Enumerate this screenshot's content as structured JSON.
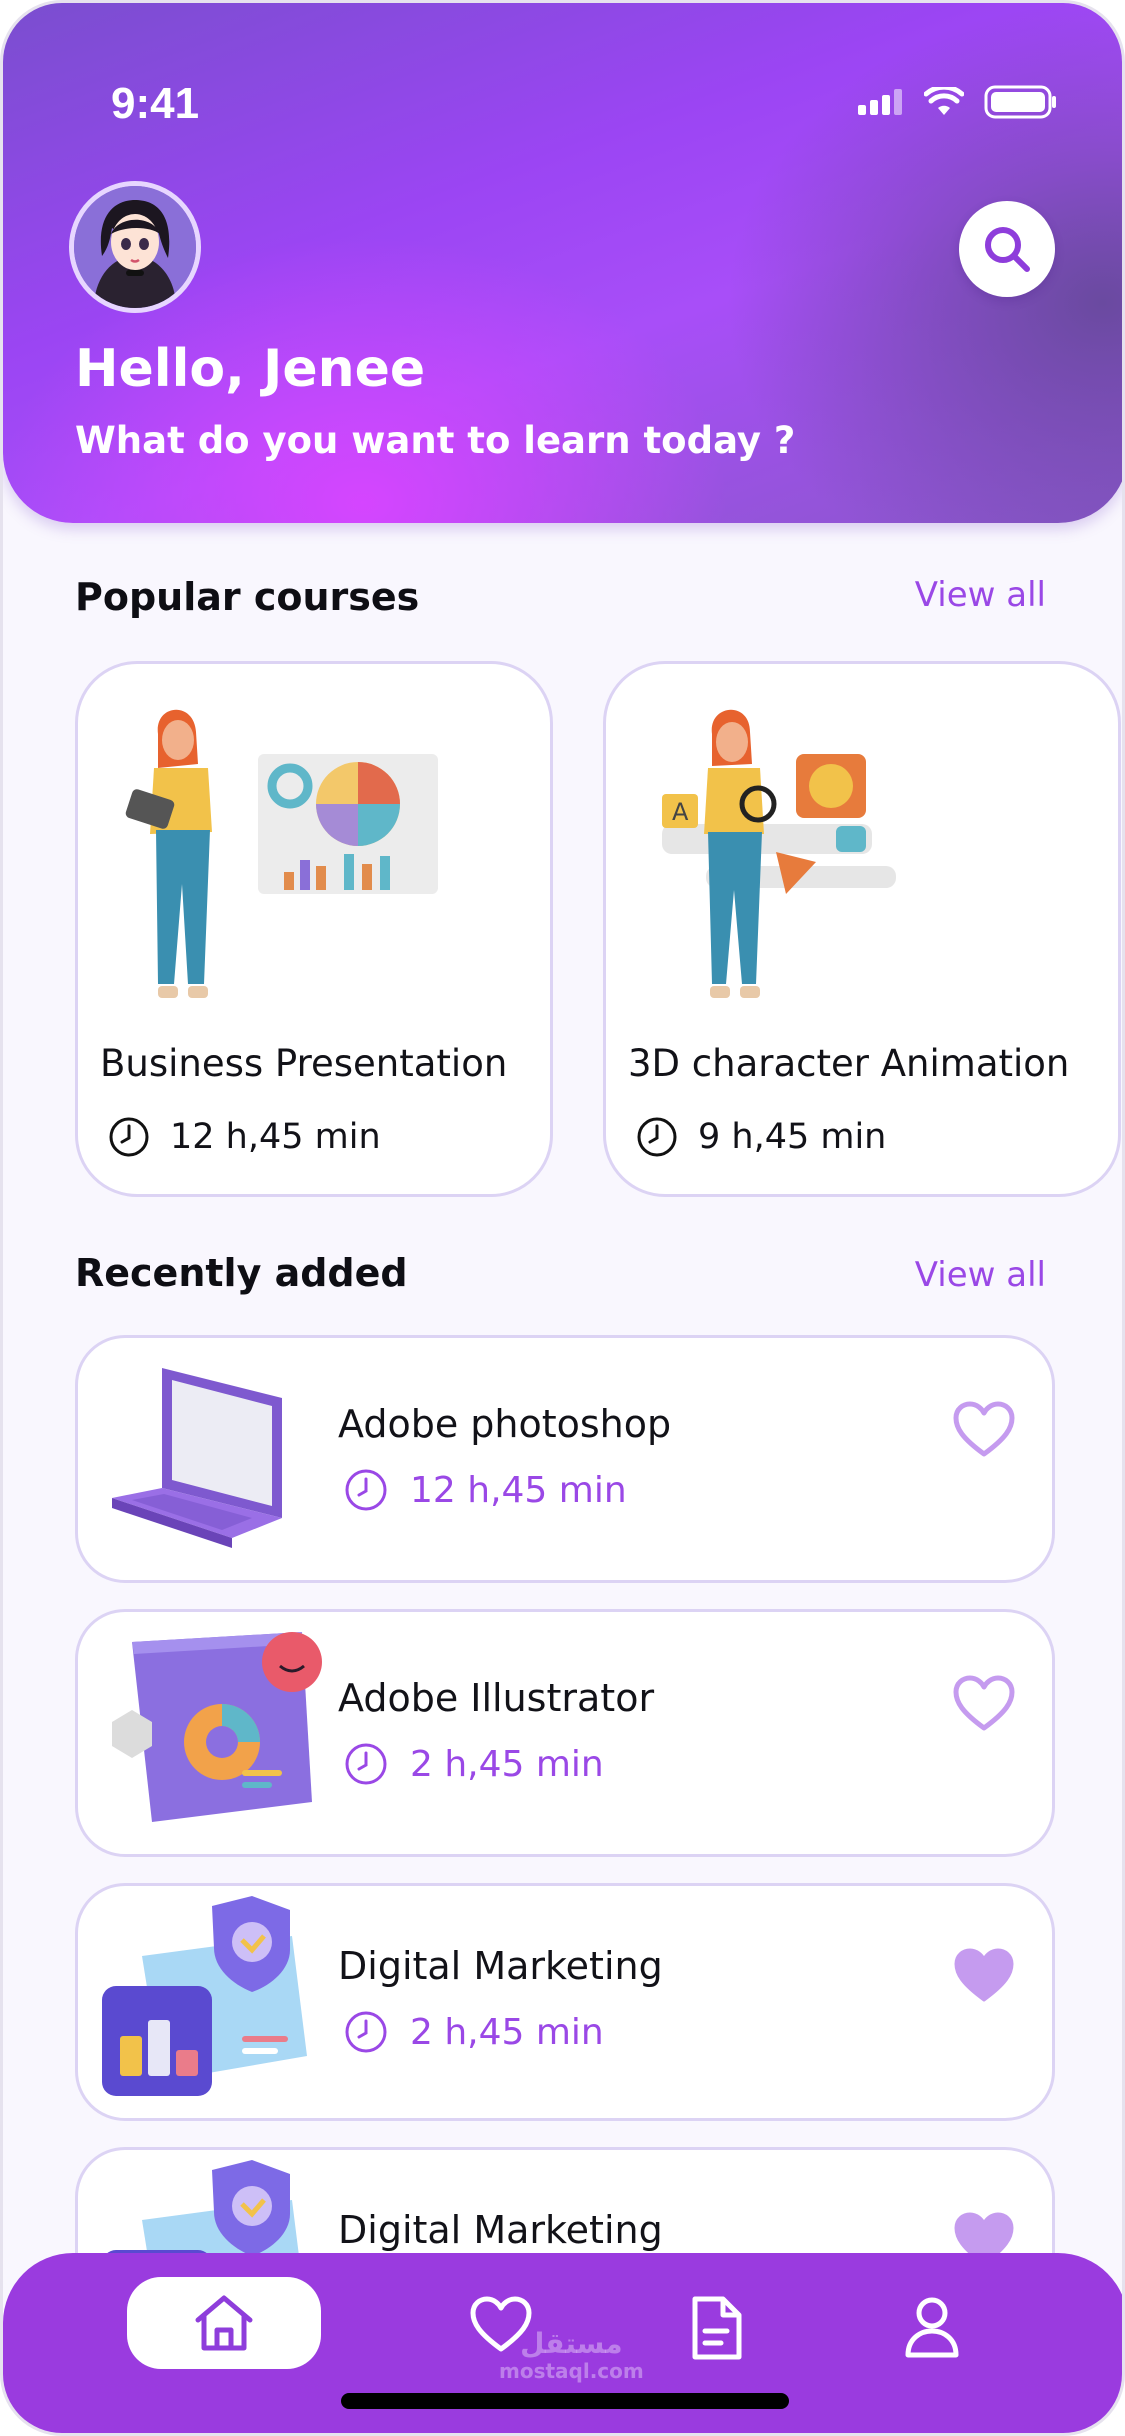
{
  "status_bar": {
    "time": "9:41"
  },
  "header": {
    "greeting": "Hello, Jenee",
    "subtitle": "What do you want to learn today ?"
  },
  "popular": {
    "title": "Popular courses",
    "view_all": "View all",
    "courses": [
      {
        "title": "Business Presentation",
        "duration": "12 h,45 min"
      },
      {
        "title": "3D character Animation",
        "duration": "9 h,45 min"
      }
    ]
  },
  "recent": {
    "title": "Recently added",
    "view_all": "View all",
    "items": [
      {
        "name": "Adobe photoshop",
        "duration": "12 h,45 min",
        "favorite": false
      },
      {
        "name": "Adobe Illustrator",
        "duration": "2 h,45 min",
        "favorite": false
      },
      {
        "name": "Digital Marketing",
        "duration": "2 h,45 min",
        "favorite": true
      },
      {
        "name": "Digital Marketing",
        "duration": "",
        "favorite": true
      }
    ]
  },
  "bottom_nav": {
    "items": [
      "home-icon",
      "heart-icon",
      "document-icon",
      "user-icon"
    ],
    "active": "home-icon"
  },
  "watermark": {
    "arabic": "مستقل",
    "latin": "mostaql.com"
  },
  "colors": {
    "accent": "#9a48e6",
    "nav_bg": "#9a3bdf",
    "card_border": "#dcd3f4",
    "heart_filled": "#c59bef"
  }
}
